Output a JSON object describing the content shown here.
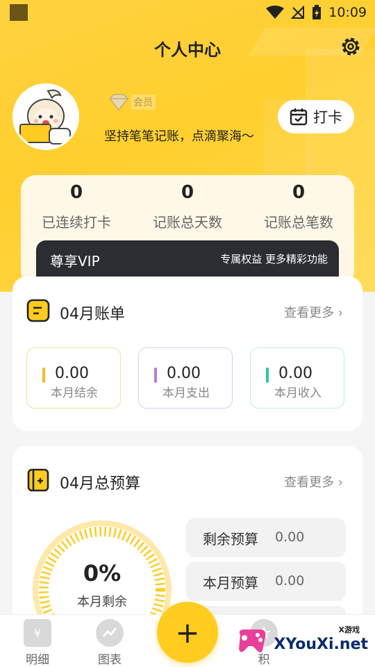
{
  "status_bar": {
    "time": "10:09"
  },
  "header": {
    "title": "个人中心"
  },
  "profile": {
    "member_badge": "会员",
    "motto": "坚持笔笔记账，点滴聚海～",
    "checkin_label": "打卡"
  },
  "stats": [
    {
      "value": "0",
      "label": "已连续打卡"
    },
    {
      "value": "0",
      "label": "记账总天数"
    },
    {
      "value": "0",
      "label": "记账总笔数"
    }
  ],
  "vip": {
    "title": "尊享VIP",
    "subtitle": "专属权益 更多精彩功能"
  },
  "monthly_bill": {
    "title": "04月账单",
    "more": "查看更多",
    "items": [
      {
        "value": "0.00",
        "label": "本月结余",
        "color": "#f5b82e"
      },
      {
        "value": "0.00",
        "label": "本月支出",
        "color": "#b77bdc"
      },
      {
        "value": "0.00",
        "label": "本月收入",
        "color": "#2dc9a0"
      }
    ]
  },
  "budget": {
    "title": "04月总预算",
    "more": "查看更多",
    "percent": "0%",
    "percent_label": "本月剩余",
    "rows": [
      {
        "label": "剩余预算",
        "value": "0.00"
      },
      {
        "label": "本月预算",
        "value": "0.00"
      }
    ]
  },
  "tabbar": {
    "items": [
      {
        "label": "明细",
        "icon": "receipt-icon"
      },
      {
        "label": "图表",
        "icon": "chart-icon"
      },
      {
        "label": "积",
        "icon": "star-icon"
      }
    ],
    "add_label": "+"
  },
  "watermark": {
    "text": "XYouXi.net",
    "small": "X游戏"
  },
  "colors": {
    "accent": "#ffcc1f",
    "vip_bg": "#2b2d33"
  }
}
